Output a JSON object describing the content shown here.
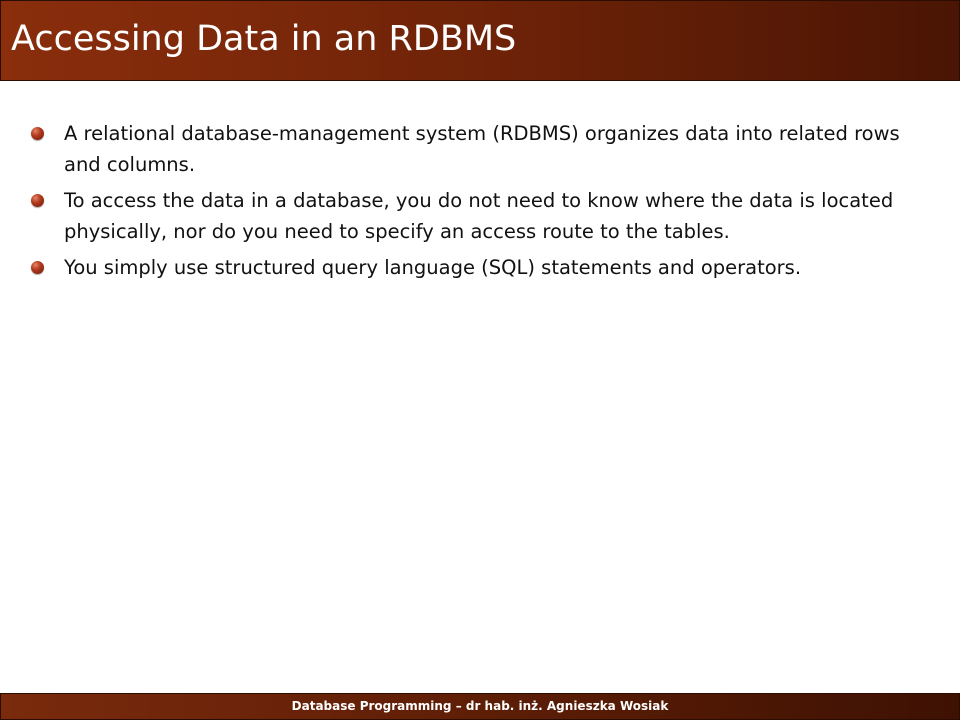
{
  "slide": {
    "title": "Accessing Data in an RDBMS",
    "bullets": [
      "A relational database-management system (RDBMS) organizes data into related rows and columns.",
      "To access the data in a database, you do not need to know where the data is located physically, nor do you need to specify an access route to the tables.",
      "You simply use structured query language (SQL) statements and operators."
    ],
    "footer": "Database Programming – dr hab. inż. Agnieszka Wosiak"
  },
  "colors": {
    "title_bar": "#6f2308",
    "footer_bar": "#5e1e06",
    "bullet": "#b23a1d",
    "title_text": "#ffffff",
    "body_text": "#111111"
  }
}
